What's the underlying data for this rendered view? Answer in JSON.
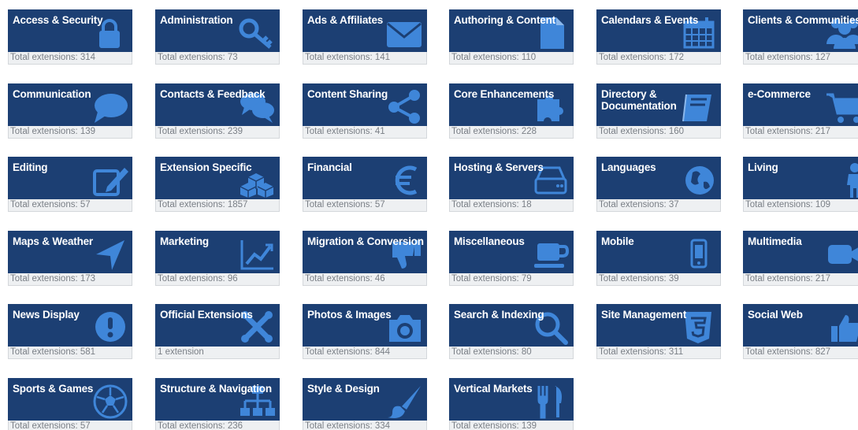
{
  "accent_color": "#1c3f73",
  "icon_color": "#3f86d9",
  "categories": [
    {
      "title": "Access & Security",
      "count": "Total extensions: 314",
      "icon": "padlock-icon"
    },
    {
      "title": "Administration",
      "count": "Total extensions: 73",
      "icon": "key-icon"
    },
    {
      "title": "Ads & Affiliates",
      "count": "Total extensions: 141",
      "icon": "envelope-icon"
    },
    {
      "title": "Authoring & Content",
      "count": "Total extensions: 110",
      "icon": "document-icon"
    },
    {
      "title": "Calendars & Events",
      "count": "Total extensions: 172",
      "icon": "calendar-icon"
    },
    {
      "title": "Clients & Communities",
      "count": "Total extensions: 127",
      "icon": "users-icon"
    },
    {
      "title": "Communication",
      "count": "Total extensions: 139",
      "icon": "speech-bubble-icon"
    },
    {
      "title": "Contacts & Feedback",
      "count": "Total extensions: 239",
      "icon": "chat-bubbles-icon"
    },
    {
      "title": "Content Sharing",
      "count": "Total extensions: 41",
      "icon": "share-icon"
    },
    {
      "title": "Core Enhancements",
      "count": "Total extensions: 228",
      "icon": "puzzle-icon"
    },
    {
      "title": "Directory &\nDocumentation",
      "count": "Total extensions: 160",
      "icon": "book-icon"
    },
    {
      "title": "e-Commerce",
      "count": "Total extensions: 217",
      "icon": "shopping-cart-icon"
    },
    {
      "title": "Editing",
      "count": "Total extensions: 57",
      "icon": "edit-icon"
    },
    {
      "title": "Extension Specific",
      "count": "Total extensions: 1857",
      "icon": "cubes-icon"
    },
    {
      "title": "Financial",
      "count": "Total extensions: 57",
      "icon": "euro-icon"
    },
    {
      "title": "Hosting & Servers",
      "count": "Total extensions: 18",
      "icon": "hard-drive-icon"
    },
    {
      "title": "Languages",
      "count": "Total extensions: 37",
      "icon": "globe-icon"
    },
    {
      "title": "Living",
      "count": "Total extensions: 109",
      "icon": "person-icon"
    },
    {
      "title": "Maps & Weather",
      "count": "Total extensions: 173",
      "icon": "location-arrow-icon"
    },
    {
      "title": "Marketing",
      "count": "Total extensions: 96",
      "icon": "line-chart-icon"
    },
    {
      "title": "Migration & Conversion",
      "count": "Total extensions: 46",
      "icon": "thumbs-down-icon"
    },
    {
      "title": "Miscellaneous",
      "count": "Total extensions: 79",
      "icon": "coffee-cup-icon"
    },
    {
      "title": "Mobile",
      "count": "Total extensions: 39",
      "icon": "mobile-phone-icon"
    },
    {
      "title": "Multimedia",
      "count": "Total extensions: 217",
      "icon": "video-camera-icon"
    },
    {
      "title": "News Display",
      "count": "Total extensions: 581",
      "icon": "exclamation-icon"
    },
    {
      "title": "Official Extensions",
      "count": "1 extension",
      "icon": "joomla-logo-icon"
    },
    {
      "title": "Photos & Images",
      "count": "Total extensions: 844",
      "icon": "camera-icon"
    },
    {
      "title": "Search & Indexing",
      "count": "Total extensions: 80",
      "icon": "search-icon"
    },
    {
      "title": "Site Management",
      "count": "Total extensions: 311",
      "icon": "html5-icon"
    },
    {
      "title": "Social Web",
      "count": "Total extensions: 827",
      "icon": "thumbs-up-icon"
    },
    {
      "title": "Sports & Games",
      "count": "Total extensions: 57",
      "icon": "soccer-ball-icon"
    },
    {
      "title": "Structure & Navigation",
      "count": "Total extensions: 236",
      "icon": "sitemap-icon"
    },
    {
      "title": "Style & Design",
      "count": "Total extensions: 334",
      "icon": "paintbrush-icon"
    },
    {
      "title": "Vertical Markets",
      "count": "Total extensions: 139",
      "icon": "cutlery-icon"
    }
  ]
}
